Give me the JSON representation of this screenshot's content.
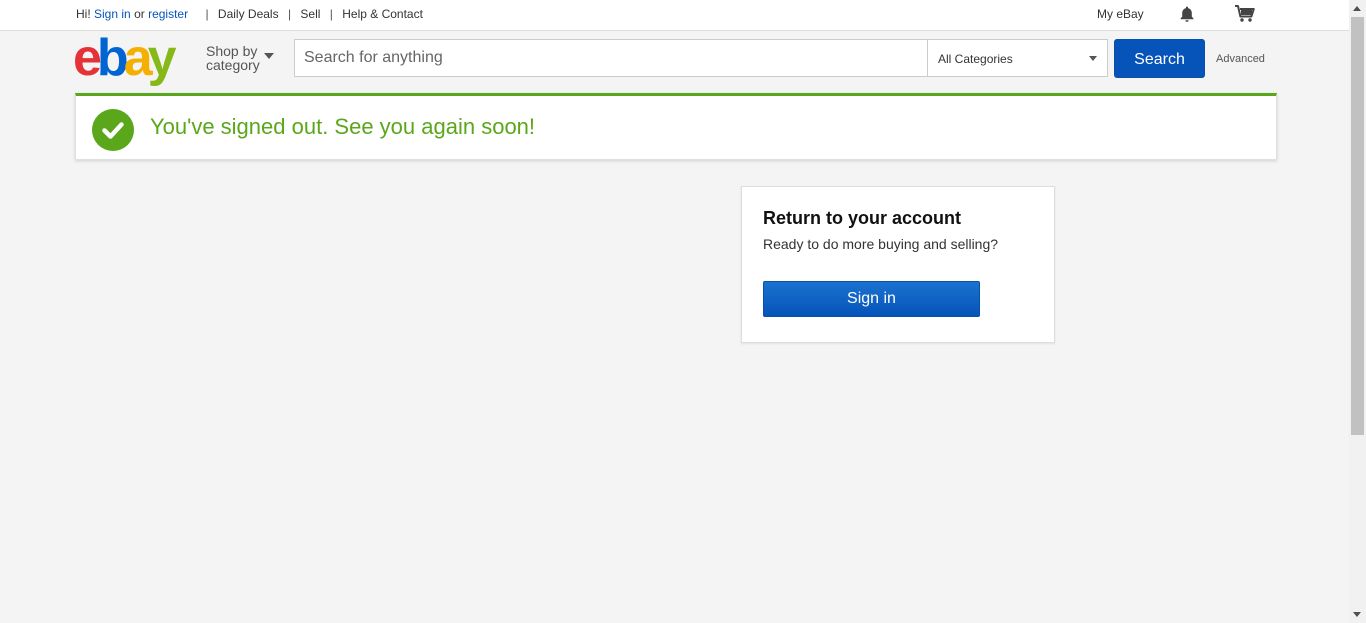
{
  "topbar": {
    "greeting": "Hi!",
    "sign_in": "Sign in",
    "or": "or",
    "register": "register",
    "links": [
      "Daily Deals",
      "Sell",
      "Help & Contact"
    ],
    "my_ebay": "My eBay"
  },
  "header": {
    "logo": {
      "e": "e",
      "b": "b",
      "a": "a",
      "y": "y"
    },
    "shop_by_line1": "Shop by",
    "shop_by_line2": "category",
    "search_placeholder": "Search for anything",
    "category_selected": "All Categories",
    "search_button": "Search",
    "advanced": "Advanced"
  },
  "alert": {
    "message": "You've signed out. See you again soon!",
    "color": "#5ba71b"
  },
  "card": {
    "title": "Return to your account",
    "subtitle": "Ready to do more buying and selling?",
    "button": "Sign in"
  },
  "colors": {
    "link": "#0654ba",
    "button": "#0654ba",
    "success": "#5ba71b"
  }
}
